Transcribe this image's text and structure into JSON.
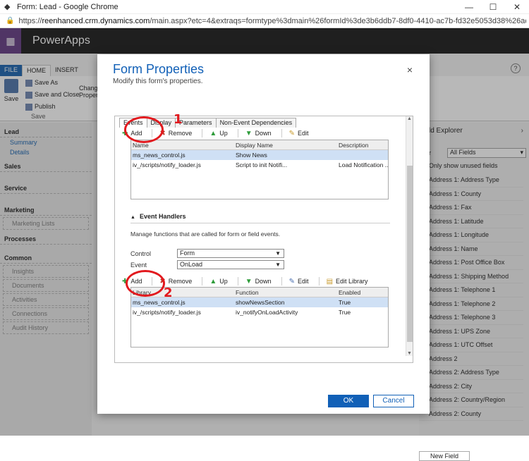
{
  "window": {
    "title": "Form: Lead - Google Chrome",
    "url_host": "reenhanced.crm.dynamics.com",
    "url_prefix": "https://",
    "url_rest": "/main.aspx?etc=4&extraqs=formtype%3dmain%26formId%3de3b6ddb7-8df0-4410-ac7b-fd32e5053d38%26action%3d..."
  },
  "app": {
    "brand": "PowerApps",
    "ribbon_tabs": [
      "FILE",
      "HOME",
      "INSERT"
    ],
    "save": "Save",
    "save_as": "Save As",
    "save_and_close": "Save and Close",
    "publish": "Publish",
    "group_save": "Save",
    "change_props": "Chang Proper"
  },
  "leftnav": {
    "lead": "Lead",
    "summary": "Summary",
    "details": "Details",
    "sales": "Sales",
    "service": "Service",
    "marketing": "Marketing",
    "marketing_lists": "Marketing Lists",
    "processes": "Processes",
    "common": "Common",
    "insights": "Insights",
    "documents": "Documents",
    "activities": "Activities",
    "connections": "Connections",
    "audit_history": "Audit History"
  },
  "field_explorer": {
    "title": "ld Explorer",
    "filter_label": "r",
    "filter_value": "All Fields",
    "only_unused": "Only show unused fields",
    "fields": [
      "Address 1: Address Type",
      "Address 1: County",
      "Address 1: Fax",
      "Address 1: Latitude",
      "Address 1: Longitude",
      "Address 1: Name",
      "Address 1: Post Office Box",
      "Address 1: Shipping Method",
      "Address 1: Telephone 1",
      "Address 1: Telephone 2",
      "Address 1: Telephone 3",
      "Address 1: UPS Zone",
      "Address 1: UTC Offset",
      "Address 2",
      "Address 2: Address Type",
      "Address 2: City",
      "Address 2: Country/Region",
      "Address 2: County"
    ],
    "new_field": "New Field"
  },
  "dialog": {
    "title": "Form Properties",
    "subtitle": "Modify this form's properties.",
    "close": "×",
    "tabs": [
      "Events",
      "Display",
      "Parameters",
      "Non-Event Dependencies"
    ],
    "lib_toolbar": {
      "add": "Add",
      "remove": "Remove",
      "up": "Up",
      "down": "Down",
      "edit": "Edit"
    },
    "lib_headers": [
      "Name",
      "Display Name",
      "Description"
    ],
    "lib_rows": [
      [
        "ms_news_control.js",
        "Show News",
        ""
      ],
      [
        "iv_/scripts/notify_loader.js",
        "Script to init Notifi...",
        "Load Notification ..."
      ]
    ],
    "handlers_title": "Event Handlers",
    "handlers_desc": "Manage functions that are called for form or field events.",
    "control_label": "Control",
    "control_value": "Form",
    "event_label": "Event",
    "event_value": "OnLoad",
    "h_toolbar": {
      "add": "Add",
      "remove": "Remove",
      "up": "Up",
      "down": "Down",
      "edit": "Edit",
      "edit_library": "Edit Library"
    },
    "h_headers": [
      "Library",
      "Function",
      "Enabled"
    ],
    "h_rows": [
      [
        "ms_news_control.js",
        "showNewsSection",
        "True"
      ],
      [
        "iv_/scripts/notify_loader.js",
        "iv_notifyOnLoadActivity",
        "True"
      ]
    ],
    "annot_1": "1",
    "annot_2": "2",
    "ok": "OK",
    "cancel": "Cancel"
  }
}
